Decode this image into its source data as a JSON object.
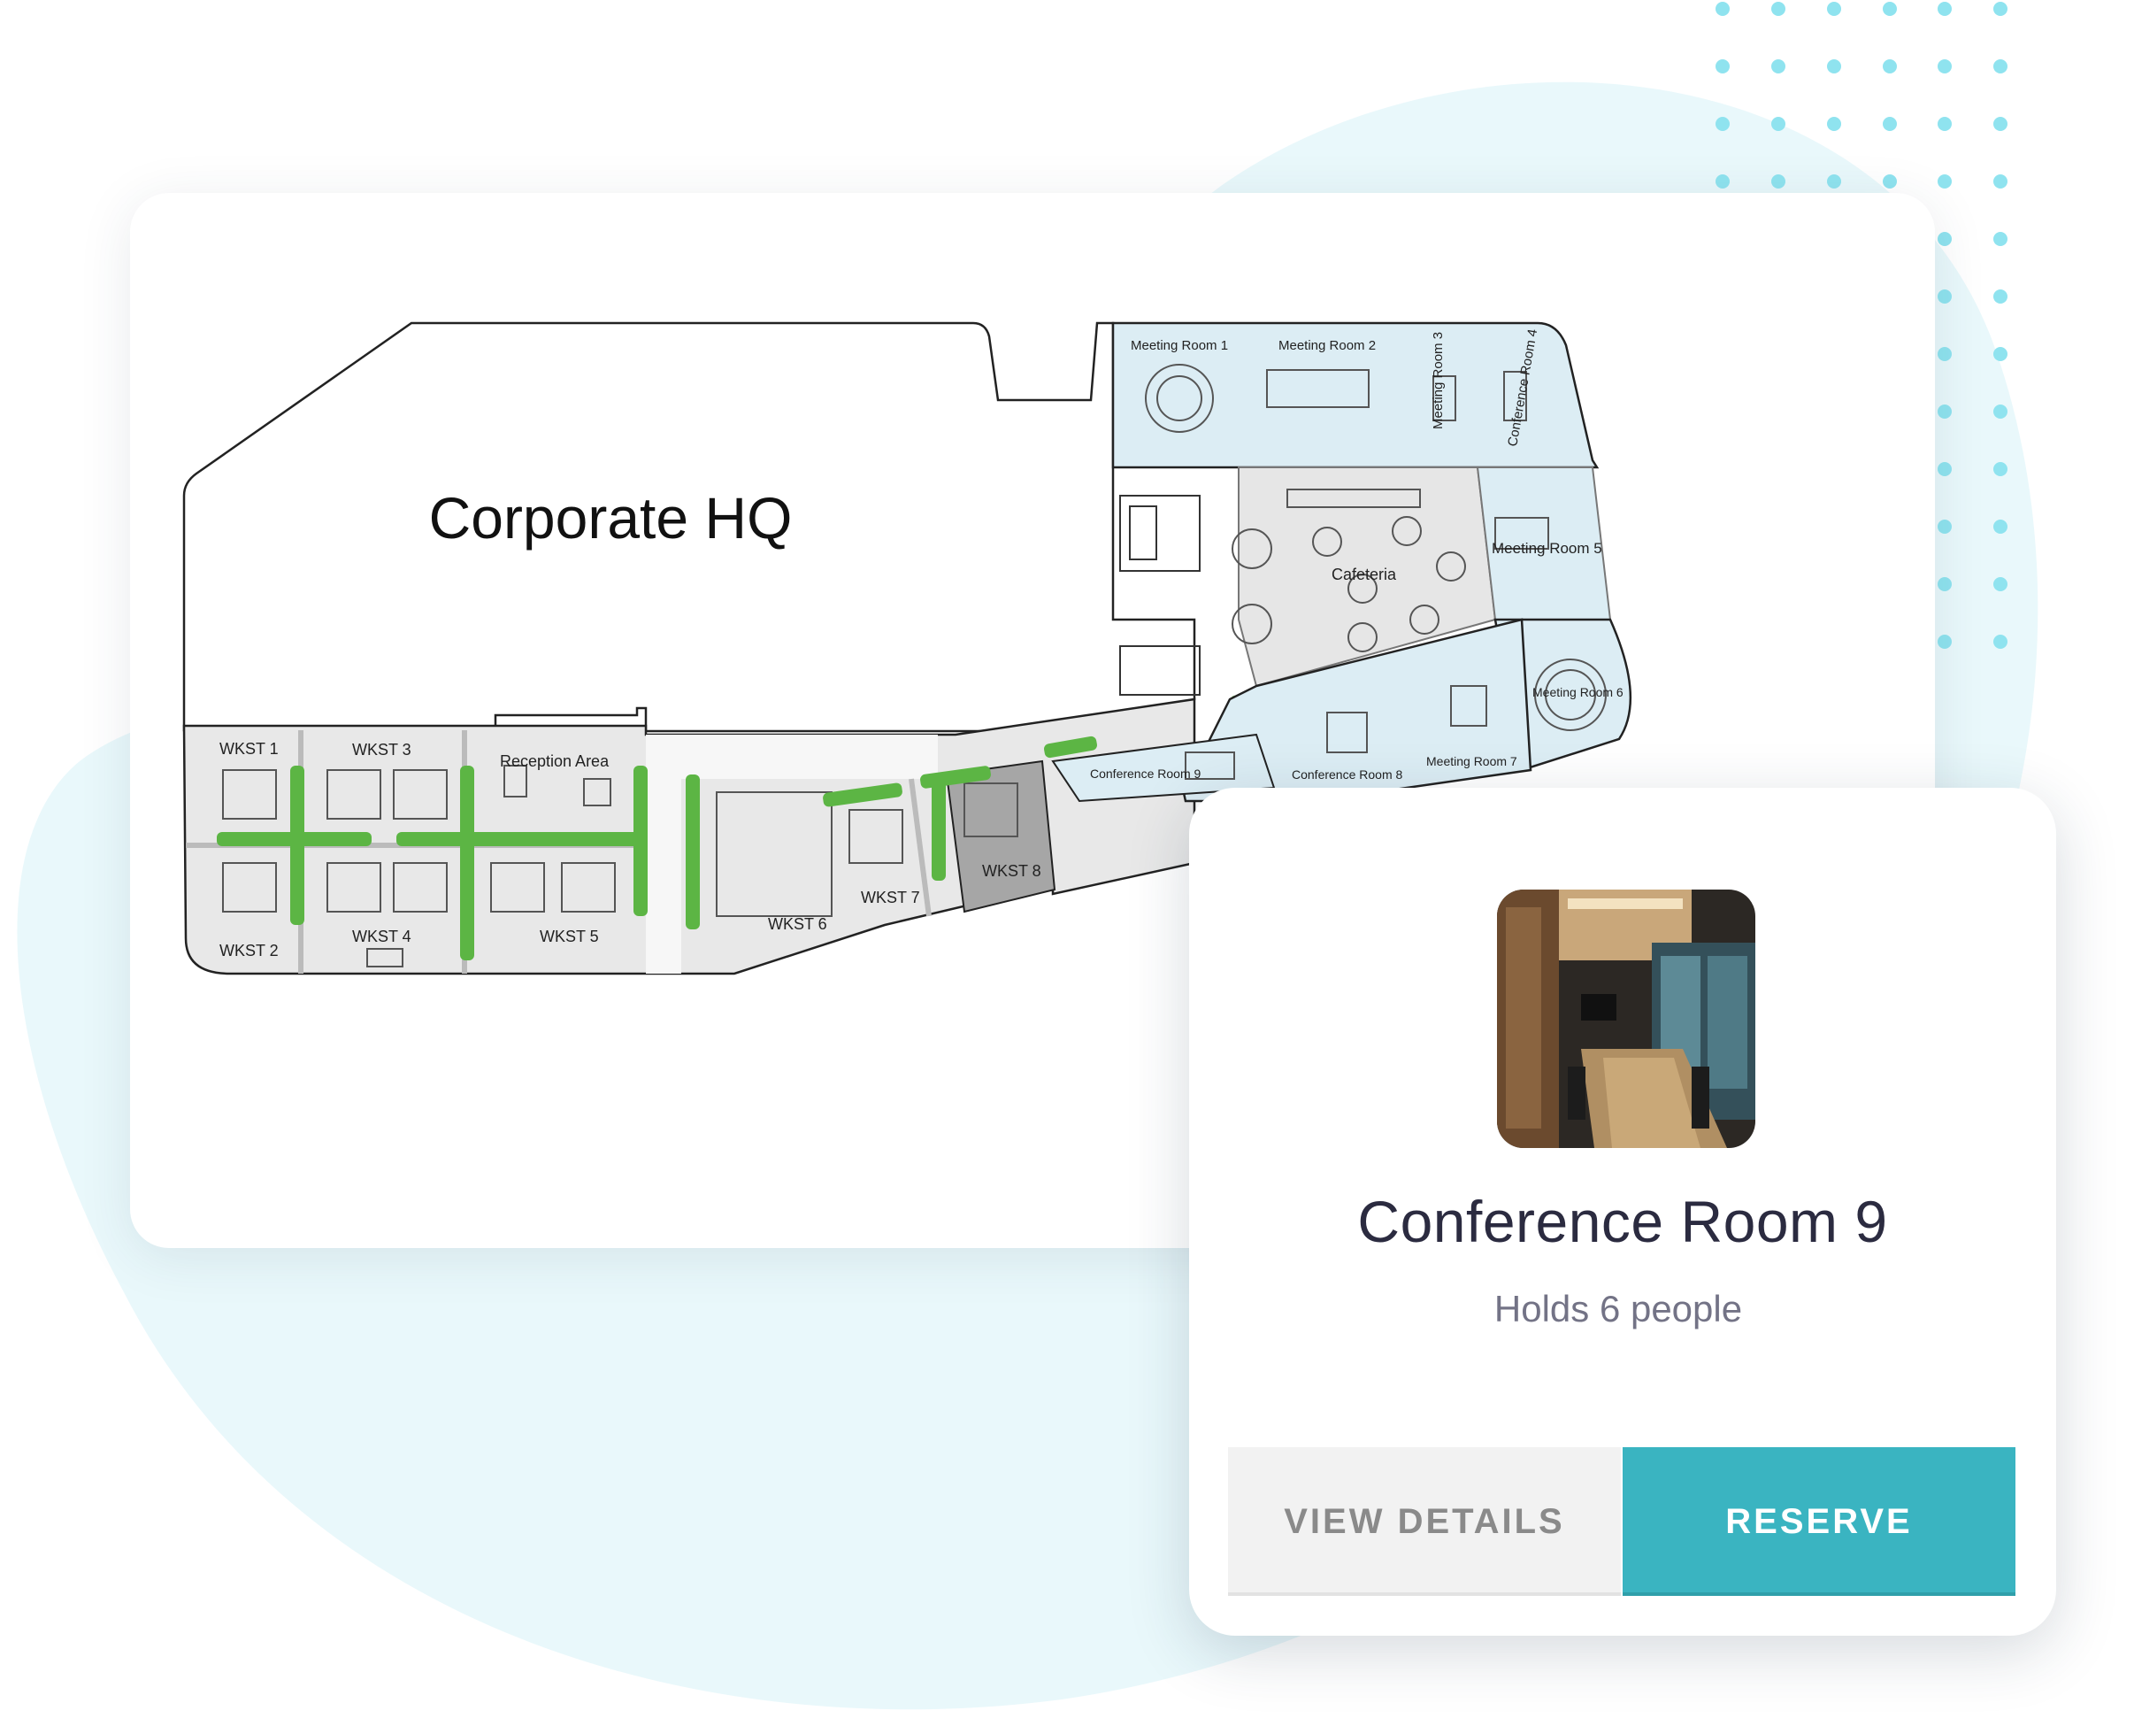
{
  "floorplan": {
    "title": "Corporate HQ",
    "rooms": {
      "meeting_room_1": "Meeting Room 1",
      "meeting_room_2": "Meeting Room 2",
      "meeting_room_3": "Meeting Room 3",
      "conference_room_4": "Conference Room 4",
      "meeting_room_5": "Meeting Room 5",
      "meeting_room_6": "Meeting Room 6",
      "meeting_room_7": "Meeting Room 7",
      "conference_room_8": "Conference Room 8",
      "conference_room_9": "Conference Room 9",
      "cafeteria": "Cafeteria",
      "reception": "Reception Area",
      "wkst_1": "WKST 1",
      "wkst_2": "WKST 2",
      "wkst_3": "WKST 3",
      "wkst_4": "WKST 4",
      "wkst_5": "WKST 5",
      "wkst_6": "WKST 6",
      "wkst_7": "WKST 7",
      "wkst_8": "WKST 8"
    }
  },
  "selected_room": {
    "name": "Conference Room 9",
    "capacity": "Holds 6 people",
    "view_details_label": "VIEW DETAILS",
    "reserve_label": "RESERVE"
  },
  "colors": {
    "accent": "#3ab4c1",
    "background_blob": "#e9f8fb",
    "dots": "#8fe3ef",
    "room_fill": "#dcedf4",
    "plants": "#4fae3b"
  }
}
